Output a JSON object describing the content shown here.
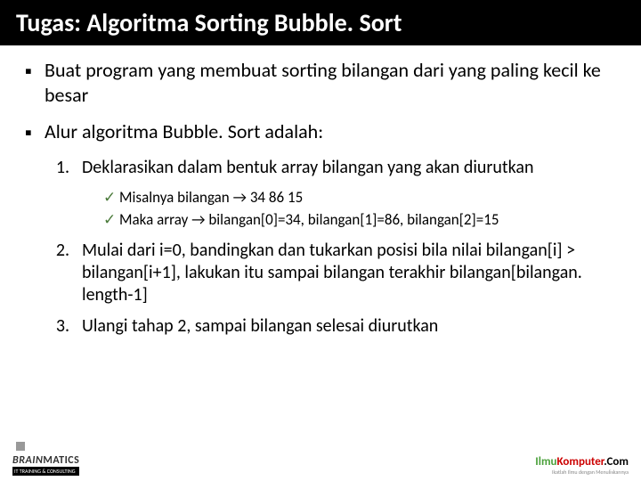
{
  "header": "Tugas: Algoritma Sorting Bubble. Sort",
  "bullet1": "Buat program yang membuat sorting bilangan dari yang paling kecil ke besar",
  "bullet2": "Alur algoritma Bubble. Sort adalah:",
  "ol": {
    "n1": "1.",
    "t1": "Deklarasikan dalam bentuk array bilangan yang akan diurutkan",
    "s1a": "Misalnya bilangan → 34  86  15",
    "s1b": "Maka array → bilangan[0]=34, bilangan[1]=86, bilangan[2]=15",
    "n2": "2.",
    "t2": "Mulai dari i=0, bandingkan dan tukarkan posisi bila nilai bilangan[i] > bilangan[i+1], lakukan itu sampai bilangan terakhir bilangan[bilangan. length-1]",
    "n3": "3.",
    "t3": "Ulangi tahap 2, sampai bilangan selesai diurutkan"
  },
  "foot": {
    "brain1": "BRAIN",
    "brain2": "MATICS",
    "brainSub": "IT TRAINING & CONSULTING",
    "ilmu": "Ilmu",
    "komp": "Komputer",
    "com": ".Com",
    "tag": "Ikatlah Ilmu dengan Menuliskannya"
  }
}
